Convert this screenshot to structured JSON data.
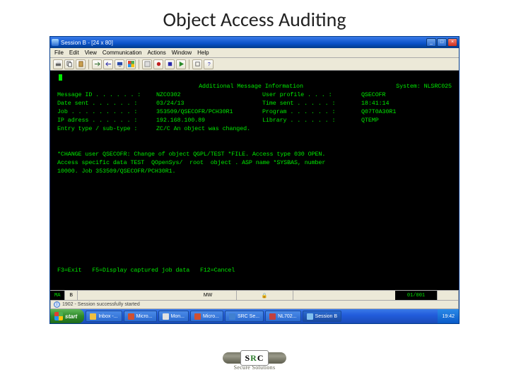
{
  "slide": {
    "title": "Object Access Auditing"
  },
  "window": {
    "title": "Session B - [24 x 80]",
    "menu": [
      "File",
      "Edit",
      "View",
      "Communication",
      "Actions",
      "Window",
      "Help"
    ]
  },
  "terminal": {
    "header_title": "Additional Message Information",
    "system_label": "System:",
    "system": "NLSRC025",
    "rows": [
      {
        "l1": "Message ID . . . . . . :",
        "v1": "NZCO302",
        "l2": "User profile  . . . :",
        "v2": "QSECOFR"
      },
      {
        "l1": "Date sent  . . . . . . :",
        "v1": "03/24/13",
        "l2": "Time sent . . . . . :",
        "v2": "18:41:14"
      },
      {
        "l1": "Job  . . . . . . . . . :",
        "v1": "353509/QSECOFR/PCH30R1",
        "l2": "Program . . . . . . :",
        "v2": "Q07T0A30R1"
      },
      {
        "l1": "IP adress  . . . . . . :",
        "v1": "192.168.100.89",
        "l2": "Library . . . . . . :",
        "v2": "QTEMP"
      },
      {
        "l1": "Entry type / sub-type  :",
        "v1": "ZC/C   An object was changed.",
        "l2": "",
        "v2": ""
      }
    ],
    "body": [
      "*CHANGE user QSECOFR: Change of object QGPL/TEST *FILE. Access type 030 OPEN.",
      "Access specific data TEST  QOpenSys/  root  object . ASP name *SYSBAS, number",
      "10000. Job 353509/QSECOFR/PCH30R1."
    ],
    "fkeys": "F3=Exit   F5=Display captured job data   F12=Cancel"
  },
  "status": {
    "left1": "MA",
    "left2": "B",
    "mid": "MW",
    "coord": "01/001"
  },
  "msgbar": {
    "text": "1902 - Session successfully started"
  },
  "taskbar": {
    "start": "start",
    "items": [
      "Inbox -...",
      "Micro...",
      "Mon...",
      "Micro...",
      "SRC Se...",
      "NL702...",
      "Session B"
    ],
    "clock": "19:42"
  },
  "logo": {
    "s": "S",
    "r": "R",
    "c": "C",
    "sub": "Secure Solutions"
  }
}
